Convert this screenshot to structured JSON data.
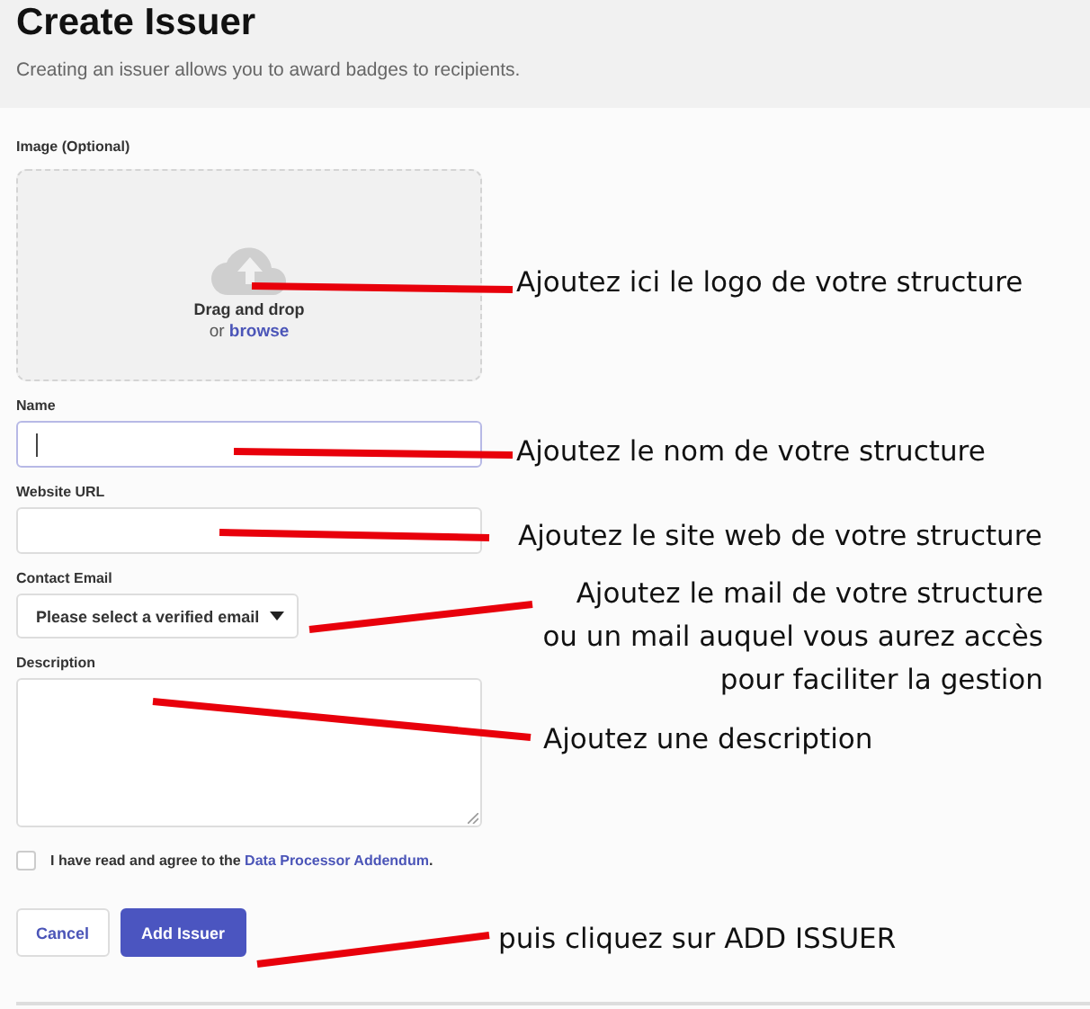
{
  "header": {
    "title": "Create Issuer",
    "subtitle": "Creating an issuer allows you to award badges to recipients."
  },
  "image_upload": {
    "label": "Image (Optional)",
    "prompt": "Drag and drop",
    "or_text": "or",
    "browse_link": "browse"
  },
  "fields": [
    {
      "kind": "text",
      "label": "Name",
      "focused": true
    },
    {
      "kind": "text",
      "label": "Website URL",
      "focused": false
    },
    {
      "kind": "select",
      "label": "Contact Email",
      "value": "Please select a verified email",
      "focused": false
    },
    {
      "kind": "textarea",
      "label": "Description",
      "focused": false
    }
  ],
  "agreement": {
    "checked": false,
    "text": "I have read and agree to the ",
    "link": "Data Processor Addendum",
    "end": "."
  },
  "buttons": [
    {
      "label": "Cancel",
      "kind": "secondary"
    },
    {
      "label": "Add Issuer",
      "kind": "primary"
    }
  ],
  "annotations": [
    {
      "lines": [
        "Ajoutez ici le logo de votre structure"
      ]
    },
    {
      "lines": [
        "Ajoutez le nom de votre structure"
      ]
    },
    {
      "lines": [
        "Ajoutez le site web de votre structure"
      ]
    },
    {
      "lines": [
        "Ajoutez le mail de votre structure",
        "ou un mail auquel vous aurez accès",
        "pour faciliter la gestion"
      ]
    },
    {
      "lines": [
        "Ajoutez une description"
      ]
    },
    {
      "lines": [
        "puis cliquez sur ADD ISSUER"
      ]
    }
  ]
}
